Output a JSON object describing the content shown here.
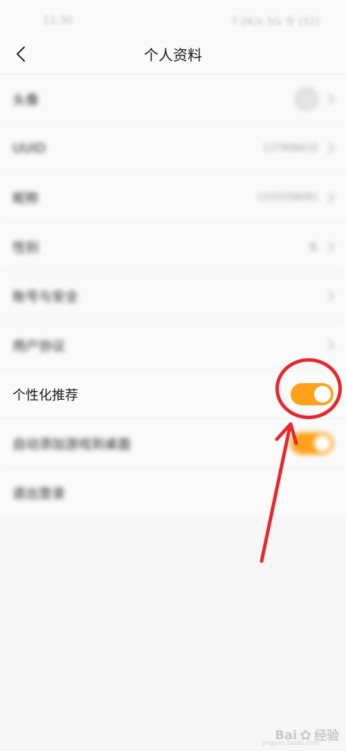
{
  "status_bar": {
    "time": "11:30",
    "system": "7.0K/s 5G 令 (32)"
  },
  "header": {
    "title": "个人资料"
  },
  "rows": [
    {
      "label": "头像",
      "value": ""
    },
    {
      "label": "UUID",
      "value": "137908432"
    },
    {
      "label": "昵称",
      "value": "1535058091"
    },
    {
      "label": "性别",
      "value": "女"
    },
    {
      "label": "账号与安全",
      "value": ""
    },
    {
      "label": "用户协议",
      "value": ""
    },
    {
      "label": "个性化推荐",
      "toggle": true
    },
    {
      "label": "自动添加游戏到桌面",
      "toggle": true
    },
    {
      "label": "退出登录"
    }
  ],
  "colors": {
    "toggle_on": "#ffa11a",
    "annotation": "#e8262d"
  },
  "watermark": {
    "brand_a": "Bai",
    "brand_b": "经验",
    "url": "jingyan.baidu.com"
  }
}
